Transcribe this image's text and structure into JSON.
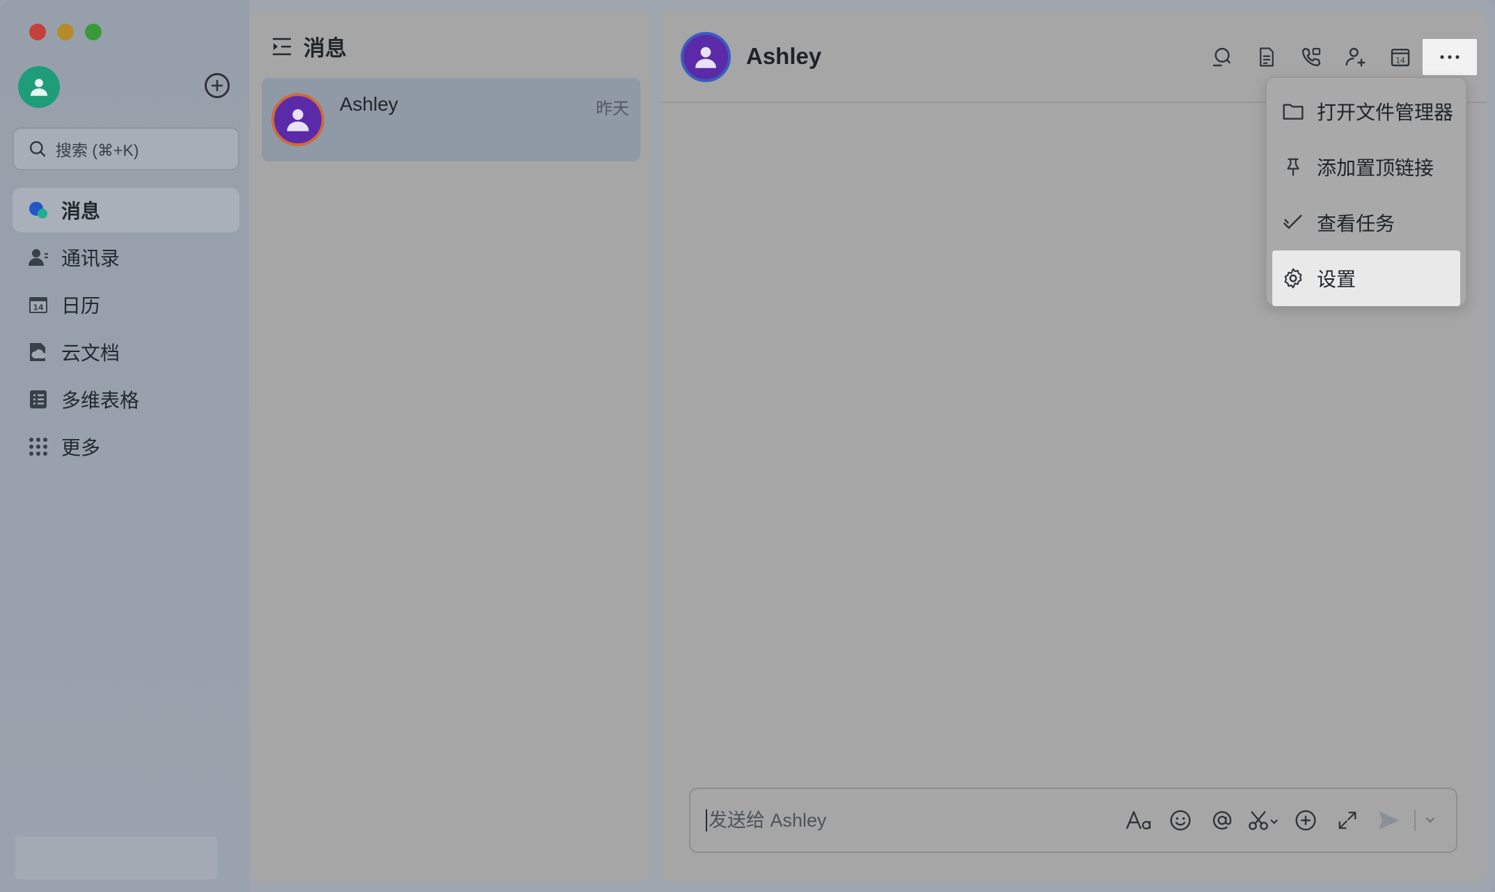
{
  "window": {
    "traffic_lights": [
      "close",
      "minimize",
      "zoom"
    ]
  },
  "sidebar": {
    "add_icon": "plus-circle-icon",
    "search": {
      "placeholder": "搜索 (⌘+K)"
    },
    "items": [
      {
        "label": "消息",
        "icon": "messages-icon",
        "active": true
      },
      {
        "label": "通讯录",
        "icon": "contacts-icon",
        "active": false
      },
      {
        "label": "日历",
        "icon": "calendar-icon",
        "active": false,
        "badge": "14"
      },
      {
        "label": "云文档",
        "icon": "cloud-docs-icon",
        "active": false
      },
      {
        "label": "多维表格",
        "icon": "base-table-icon",
        "active": false
      },
      {
        "label": "更多",
        "icon": "grid-more-icon",
        "active": false
      }
    ]
  },
  "list": {
    "title": "消息",
    "conversations": [
      {
        "name": "Ashley",
        "time": "昨天"
      }
    ]
  },
  "chat": {
    "title": "Ashley",
    "tools": [
      "search-icon",
      "document-icon",
      "phone-call-icon",
      "add-member-icon",
      "calendar-icon",
      "more-icon"
    ],
    "calendar_day": "14",
    "menu": [
      {
        "label": "打开文件管理器",
        "icon": "folder-icon"
      },
      {
        "label": "添加置顶链接",
        "icon": "pin-icon"
      },
      {
        "label": "查看任务",
        "icon": "task-check-icon"
      },
      {
        "label": "设置",
        "icon": "gear-icon",
        "active": true
      }
    ],
    "composer": {
      "placeholder": "发送给 Ashley"
    }
  },
  "colors": {
    "close": "#c4413a",
    "minimize": "#b68b2a",
    "zoom": "#3a9a3a",
    "avatar_me": "#1f9d7a",
    "contact_avatar": "#5b2aa8"
  }
}
